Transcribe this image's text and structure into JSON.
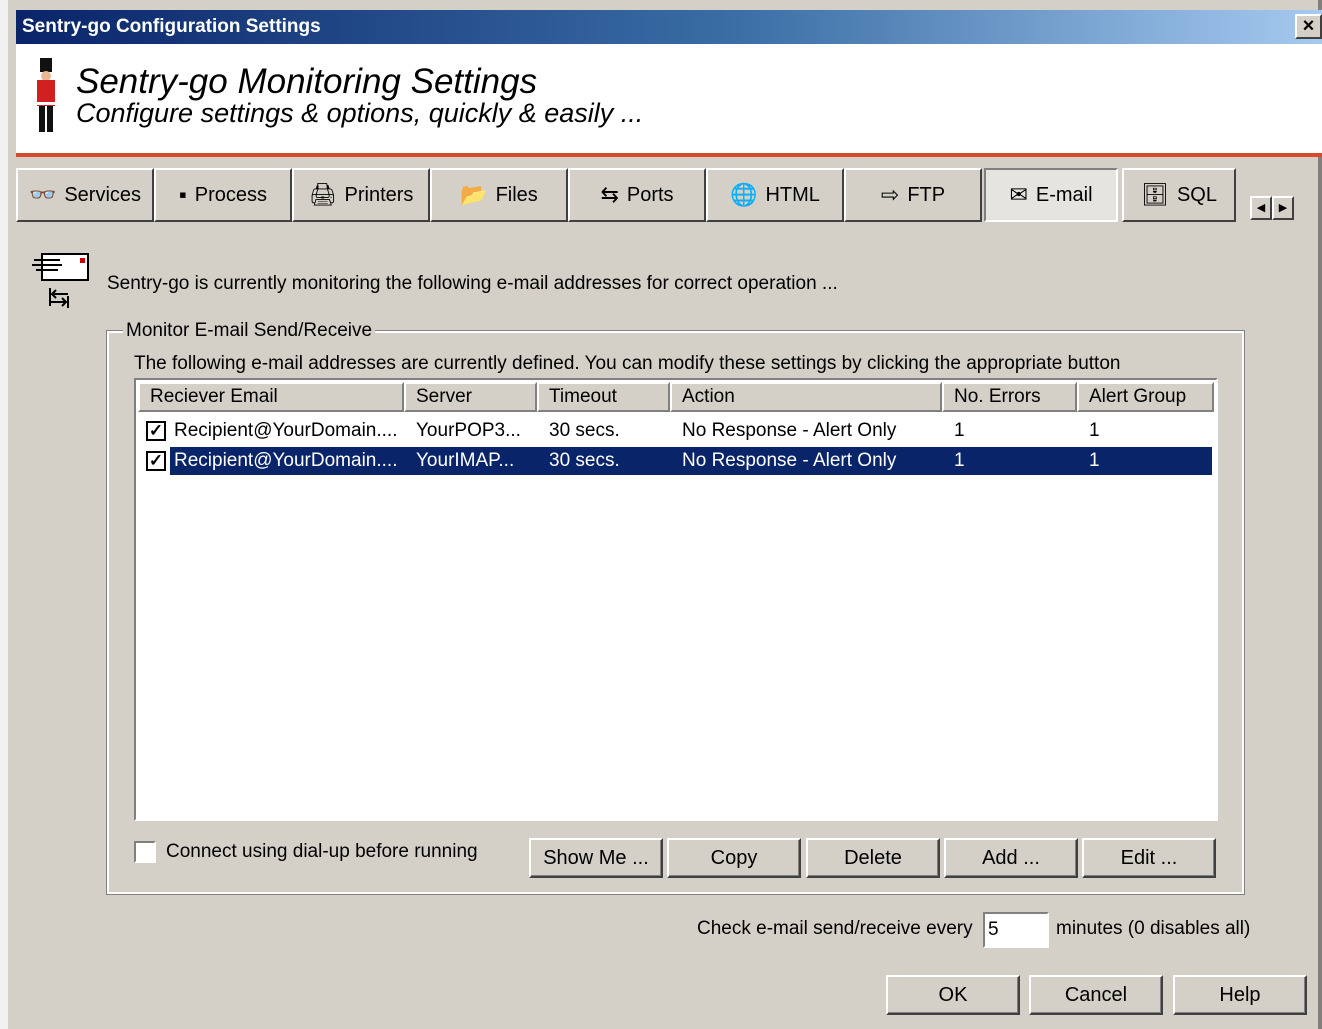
{
  "window": {
    "title": "Sentry-go Configuration Settings",
    "close_label": "×"
  },
  "header": {
    "title": "Sentry-go Monitoring Settings",
    "subtitle": "Configure settings & options, quickly & easily ..."
  },
  "tabs": [
    {
      "label": "Services",
      "icon": "glasses-icon",
      "glyph": "👓"
    },
    {
      "label": "Process",
      "icon": "process-window-icon",
      "glyph": "▪"
    },
    {
      "label": "Printers",
      "icon": "printer-icon",
      "glyph": "🖨"
    },
    {
      "label": "Files",
      "icon": "folder-icon",
      "glyph": "📂"
    },
    {
      "label": "Ports",
      "icon": "ports-icon",
      "glyph": "⇆"
    },
    {
      "label": "HTML",
      "icon": "globe-icon",
      "glyph": "🌐"
    },
    {
      "label": "FTP",
      "icon": "ftp-arrow-icon",
      "glyph": "⇨"
    },
    {
      "label": "E-mail",
      "icon": "email-icon",
      "glyph": "✉",
      "active": true
    },
    {
      "label": "SQL",
      "icon": "sql-database-icon",
      "glyph": "🗄"
    }
  ],
  "tab_scroll": {
    "left": "◀",
    "right": "▶"
  },
  "intro_text": "Sentry-go is currently monitoring the following e-mail addresses for correct operation ...",
  "group": {
    "label": "Monitor E-mail Send/Receive",
    "description": "The following e-mail addresses are currently defined. You can modify these settings by clicking the appropriate button"
  },
  "table": {
    "columns": [
      "Reciever Email",
      "Server",
      "Timeout",
      "Action",
      "No. Errors",
      "Alert Group"
    ],
    "rows": [
      {
        "checked": true,
        "selected": false,
        "cells": [
          "Recipient@YourDomain....",
          "YourPOP3...",
          "30 secs.",
          "No Response - Alert Only",
          "1",
          "1"
        ]
      },
      {
        "checked": true,
        "selected": true,
        "cells": [
          "Recipient@YourDomain....",
          "YourIMAP...",
          "30 secs.",
          "No Response - Alert Only",
          "1",
          "1"
        ]
      }
    ]
  },
  "dialup_label": "Connect using dial-up before running",
  "list_buttons": {
    "show_me": "Show Me ...",
    "copy": "Copy",
    "delete": "Delete",
    "add": "Add ...",
    "edit": "Edit ..."
  },
  "interval": {
    "label": "Check e-mail send/receive every",
    "value": "5",
    "suffix": "minutes (0 disables all)"
  },
  "dialog_buttons": {
    "ok": "OK",
    "cancel": "Cancel",
    "help": "Help"
  },
  "colors": {
    "title_bar": "#0a246a",
    "header_rule": "#d84a2e",
    "selection": "#0a246a"
  }
}
